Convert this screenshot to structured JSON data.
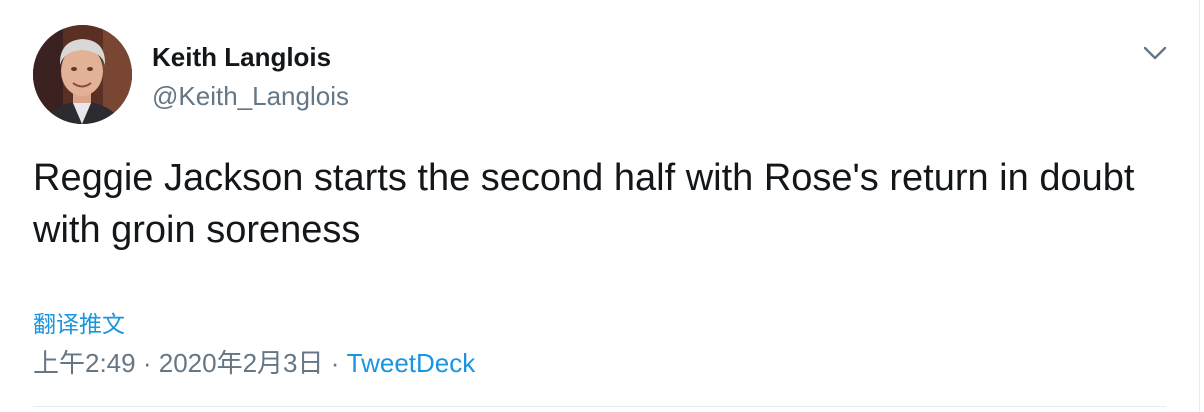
{
  "tweet": {
    "author": {
      "display_name": "Keith Langlois",
      "handle": "@Keith_Langlois"
    },
    "text": "Reggie Jackson starts the second half with Rose's return in doubt with groin soreness",
    "translate_label": "翻译推文",
    "time": "上午2:49",
    "date": "2020年2月3日",
    "separator": "·",
    "source": "TweetDeck",
    "menu_icon": "chevron-down-icon",
    "colors": {
      "link": "#1b95e0",
      "secondary": "#657786",
      "primary_text": "#14171a",
      "divider": "#e6ecf0"
    }
  }
}
